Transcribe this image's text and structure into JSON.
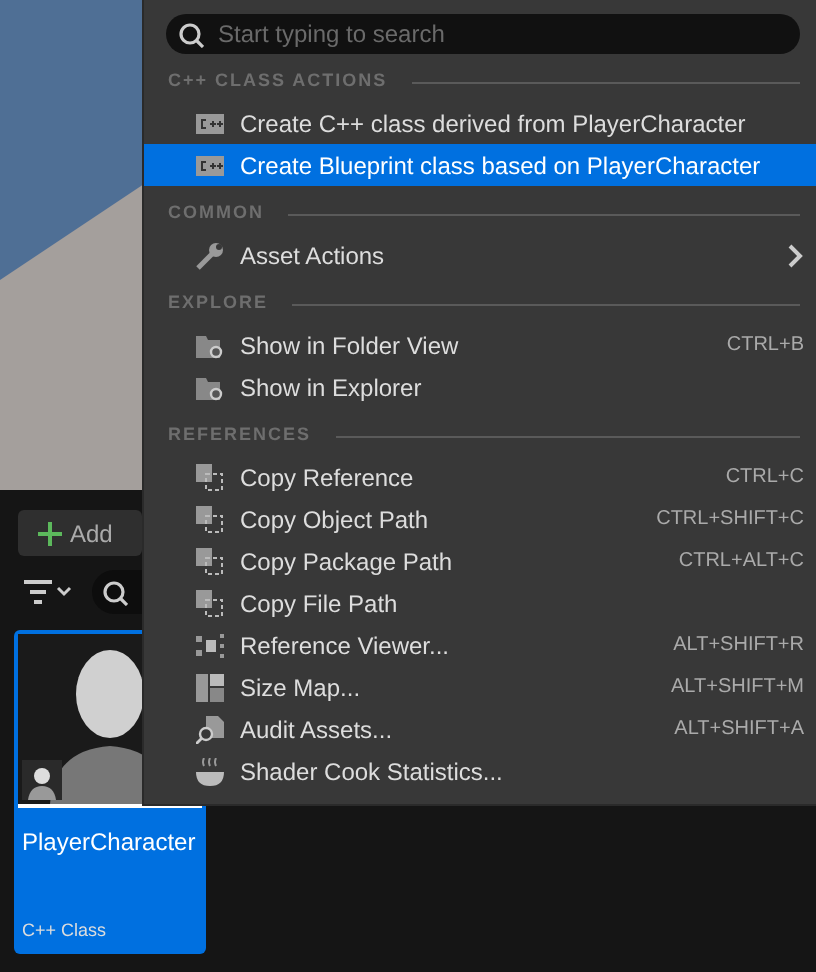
{
  "toolbar": {
    "add_button": "Add"
  },
  "asset": {
    "name": "PlayerCharacter",
    "type": "C++ Class",
    "selected": true
  },
  "menu": {
    "search": {
      "placeholder": "Start typing to search"
    },
    "sections": [
      {
        "title": "C++ CLASS ACTIONS",
        "items": [
          {
            "kind": "cpp",
            "label": "Create C++ class derived from PlayerCharacter",
            "selected": false,
            "submenu": false
          },
          {
            "kind": "cpp",
            "label": "Create Blueprint class based on PlayerCharacter",
            "selected": true,
            "submenu": false
          }
        ]
      },
      {
        "title": "COMMON",
        "items": [
          {
            "kind": "wrench",
            "label": "Asset Actions",
            "selected": false,
            "submenu": true
          }
        ]
      },
      {
        "title": "EXPLORE",
        "items": [
          {
            "kind": "folder",
            "label": "Show in Folder View",
            "shortcut": "CTRL+B",
            "selected": false,
            "submenu": false
          },
          {
            "kind": "folder",
            "label": "Show in Explorer",
            "selected": false,
            "submenu": false
          }
        ]
      },
      {
        "title": "REFERENCES",
        "items": [
          {
            "kind": "copy",
            "label": "Copy Reference",
            "shortcut": "CTRL+C",
            "selected": false,
            "submenu": false
          },
          {
            "kind": "copy",
            "label": "Copy Object Path",
            "shortcut": "CTRL+SHIFT+C",
            "selected": false,
            "submenu": false
          },
          {
            "kind": "copy",
            "label": "Copy Package Path",
            "shortcut": "CTRL+ALT+C",
            "selected": false,
            "submenu": false
          },
          {
            "kind": "copy",
            "label": "Copy File Path",
            "selected": false,
            "submenu": false
          },
          {
            "kind": "refviewer",
            "label": "Reference Viewer...",
            "shortcut": "ALT+SHIFT+R",
            "selected": false,
            "submenu": false
          },
          {
            "kind": "sizemap",
            "label": "Size Map...",
            "shortcut": "ALT+SHIFT+M",
            "selected": false,
            "submenu": false
          },
          {
            "kind": "audit",
            "label": "Audit Assets...",
            "shortcut": "ALT+SHIFT+A",
            "selected": false,
            "submenu": false
          },
          {
            "kind": "bowl",
            "label": "Shader Cook Statistics...",
            "selected": false,
            "submenu": false
          }
        ]
      }
    ]
  }
}
